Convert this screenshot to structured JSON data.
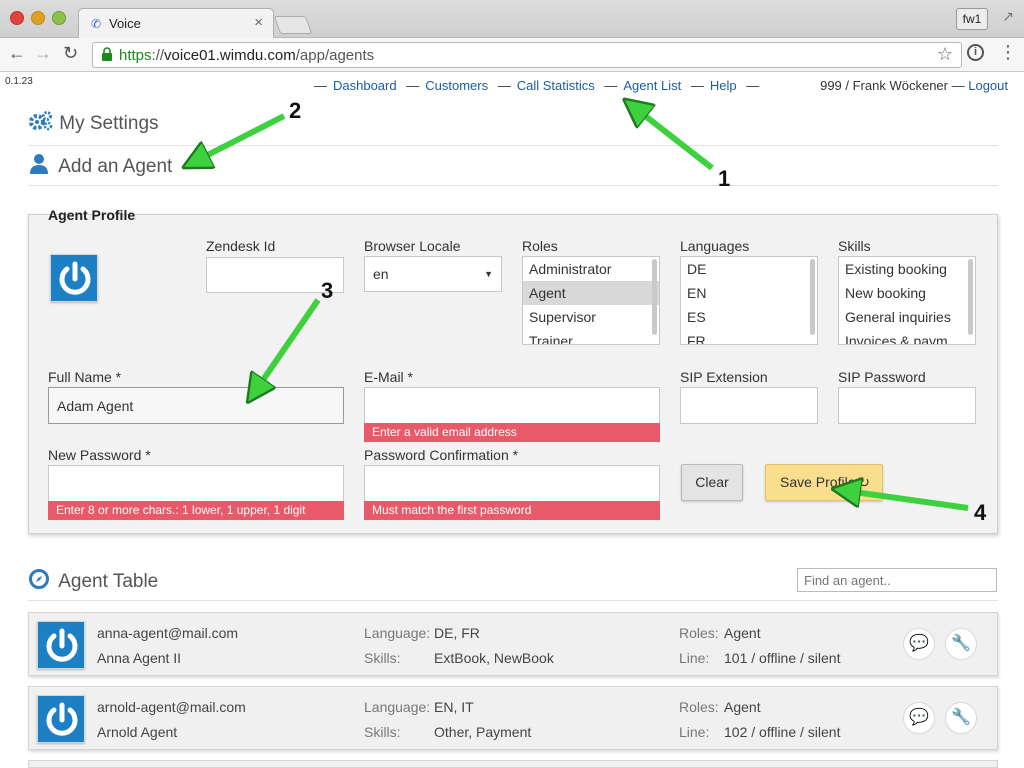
{
  "browser": {
    "tab_title": "Voice",
    "tab_close": "×",
    "profile_label": "fw1",
    "url_scheme": "https",
    "url_sep": "://",
    "url_host": "voice01.wimdu.com",
    "url_path": "/app/agents"
  },
  "app": {
    "version": "0.1.23",
    "nav": [
      "Dashboard",
      "Customers",
      "Call Statistics",
      "Agent List",
      "Help"
    ],
    "nav_dash": "—",
    "user_prefix": "999 / Frank Wöckener",
    "logout": "Logout"
  },
  "sections": {
    "my_settings": "My Settings",
    "add_agent": "Add an Agent",
    "agent_table": "Agent Table"
  },
  "profile": {
    "legend": "Agent Profile",
    "zendesk_label": "Zendesk Id",
    "zendesk_value": "",
    "locale_label": "Browser Locale",
    "locale_value": "en",
    "roles_label": "Roles",
    "roles_options": [
      "Administrator",
      "Agent",
      "Supervisor",
      "Trainer"
    ],
    "roles_selected": "Agent",
    "languages_label": "Languages",
    "languages_options": [
      "DE",
      "EN",
      "ES",
      "FR"
    ],
    "skills_label": "Skills",
    "skills_options": [
      "Existing booking",
      "New booking",
      "General inquiries",
      "Invoices & paym..."
    ],
    "fullname_label": "Full Name *",
    "fullname_value": "Adam Agent",
    "email_label": "E-Mail *",
    "email_value": "",
    "email_error": "Enter a valid email address",
    "sip_ext_label": "SIP Extension",
    "sip_pw_label": "SIP Password",
    "password_label": "New Password *",
    "password_error": "Enter 8 or more chars.: 1 lower, 1 upper, 1 digit",
    "confirm_label": "Password Confirmation *",
    "confirm_error": "Must match the first password",
    "clear_button": "Clear",
    "save_button": "Save Profile"
  },
  "table": {
    "search_placeholder": "Find an agent..",
    "language_key": "Language:",
    "skills_key": "Skills:",
    "roles_key": "Roles:",
    "line_key": "Line:",
    "agents": [
      {
        "email": "anna-agent@mail.com",
        "name": "Anna Agent II",
        "language": "DE, FR",
        "skills": "ExtBook, NewBook",
        "roles": "Agent",
        "line": "101 / offline / silent"
      },
      {
        "email": "arnold-agent@mail.com",
        "name": "Arnold Agent",
        "language": "EN, IT",
        "skills": "Other, Payment",
        "roles": "Agent",
        "line": "102 / offline / silent"
      }
    ]
  },
  "annotations": {
    "labels": [
      "1",
      "2",
      "3",
      "4"
    ],
    "color": "#3dd13d"
  },
  "icons": {
    "favicon": "phone-icon",
    "settings": "gears-icon",
    "user": "user-icon",
    "table": "compass-icon",
    "avatar": "power-icon",
    "chat": "chat-icon",
    "edit": "wrench-icon",
    "refresh": "refresh-icon"
  },
  "colors": {
    "link": "#1b5d9e",
    "accent": "#2b7bbf",
    "error": "#e85a6a",
    "save": "#f9de8e"
  }
}
